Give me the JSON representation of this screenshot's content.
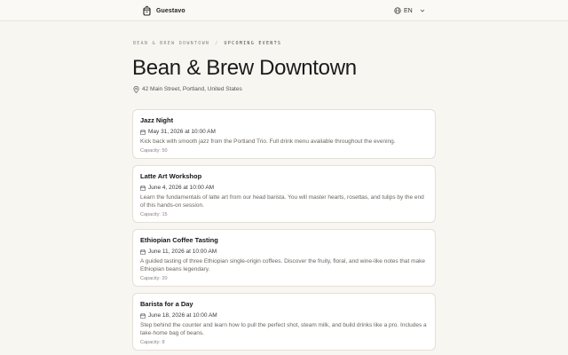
{
  "header": {
    "brand_name": "Guestavo",
    "language": "EN"
  },
  "breadcrumb": {
    "parent": "Bean & Brew Downtown",
    "separator": "/",
    "current": "Upcoming Events"
  },
  "venue": {
    "name": "Bean & Brew Downtown",
    "address": "42 Main Street, Portland, United States"
  },
  "events": [
    {
      "title": "Jazz Night",
      "date": "May 31, 2026 at 10:00 AM",
      "description": "Kick back with smooth jazz from the Portland Trio. Full drink menu available throughout the evening.",
      "capacity": "Capacity: 50"
    },
    {
      "title": "Latte Art Workshop",
      "date": "June 4, 2026 at 10:00 AM",
      "description": "Learn the fundamentals of latte art from our head barista. You will master hearts, rosettas, and tulips by the end of this hands-on session.",
      "capacity": "Capacity: 15"
    },
    {
      "title": "Ethiopian Coffee Tasting",
      "date": "June 11, 2026 at 10:00 AM",
      "description": "A guided tasting of three Ethiopian single-origin coffees. Discover the fruity, floral, and wine-like notes that make Ethiopian beans legendary.",
      "capacity": "Capacity: 20"
    },
    {
      "title": "Barista for a Day",
      "date": "June 18, 2026 at 10:00 AM",
      "description": "Step behind the counter and learn how to pull the perfect shot, steam milk, and build drinks like a pro. Includes a take-home bag of beans.",
      "capacity": "Capacity: 8"
    }
  ]
}
